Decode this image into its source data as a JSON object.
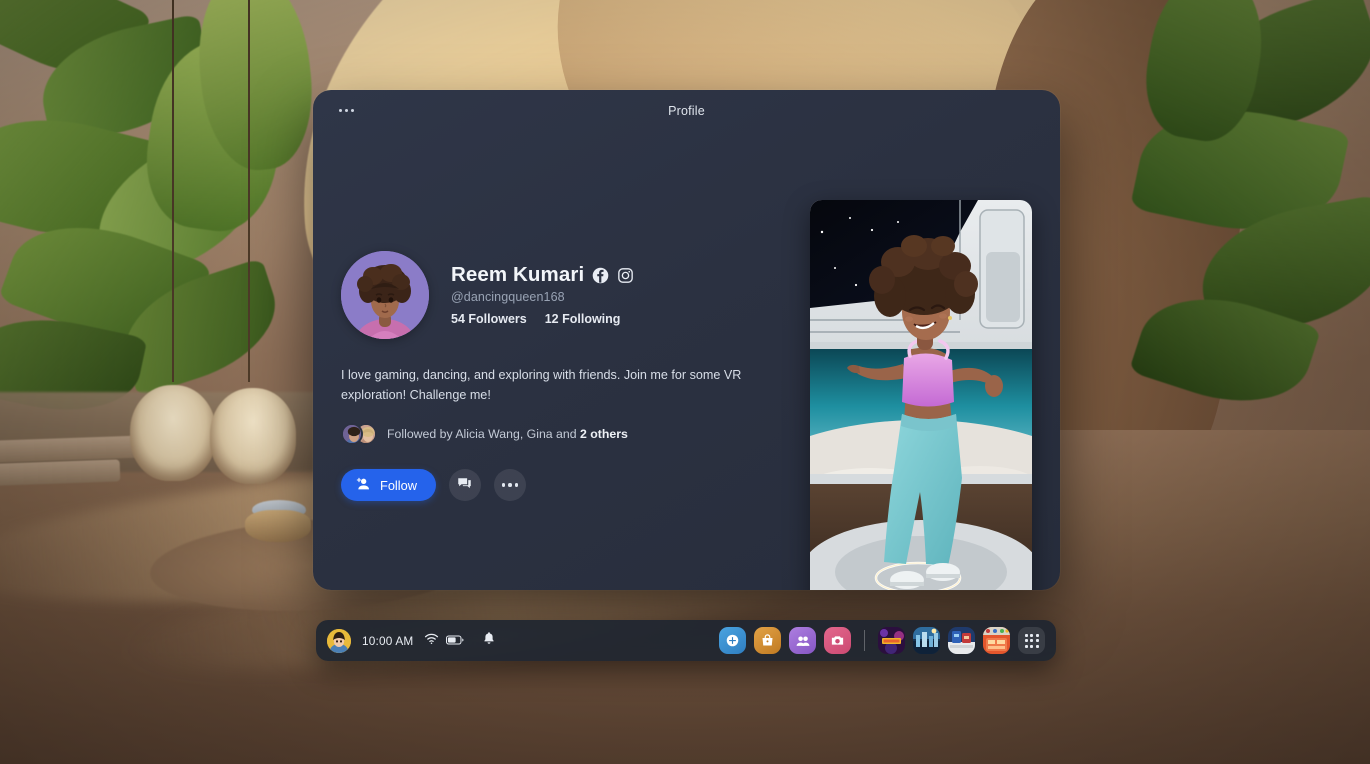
{
  "window": {
    "menu_icon": "more-horizontal-icon",
    "title": "Profile"
  },
  "profile": {
    "avatar_alt": "avatar-portrait",
    "name": "Reem Kumari",
    "social_links": [
      {
        "name": "facebook-icon",
        "label": "Facebook"
      },
      {
        "name": "instagram-icon",
        "label": "Instagram"
      }
    ],
    "handle": "@dancingqueen168",
    "followers": "54 Followers",
    "following": "12 Following",
    "bio": "I love gaming, dancing, and exploring with friends. Join me for some VR exploration! Challenge me!",
    "followed_by_prefix": "Followed by Alicia Wang, Gina and ",
    "followed_by_others": "2 others",
    "actions": {
      "follow_label": "Follow",
      "follow_icon": "person-add-icon",
      "follow_color": "#2563eb",
      "message_icon": "chat-bubble-icon",
      "more_icon": "more-horizontal-icon"
    },
    "showcase_alt": "avatar-full-body-space-station"
  },
  "taskbar": {
    "user_avatar": "user-avatar-icon",
    "time": "10:00 AM",
    "status_icons": [
      {
        "name": "wifi-icon"
      },
      {
        "name": "battery-icon"
      },
      {
        "name": "notification-bell-icon"
      }
    ],
    "system_apps": [
      {
        "name": "explore-icon",
        "color": "#3d93d6"
      },
      {
        "name": "store-icon",
        "color": "#d08a2e"
      },
      {
        "name": "people-icon",
        "color": "#9b6ad4"
      },
      {
        "name": "camera-icon",
        "color": "#d9587f"
      }
    ],
    "recent_games": [
      {
        "name": "game-thumbnail-neon",
        "color": "#4b2a6b"
      },
      {
        "name": "game-thumbnail-city",
        "color": "#2f5d86"
      },
      {
        "name": "game-thumbnail-robot",
        "color": "#2d4a80"
      },
      {
        "name": "game-thumbnail-arcade",
        "color": "#cf5a36"
      }
    ],
    "app_grid": {
      "name": "app-grid-icon"
    }
  },
  "theme": {
    "panel_bg": "#2b3141",
    "accent": "#2563eb",
    "text_primary": "#f2f5f9",
    "text_secondary": "#99a3b4"
  }
}
